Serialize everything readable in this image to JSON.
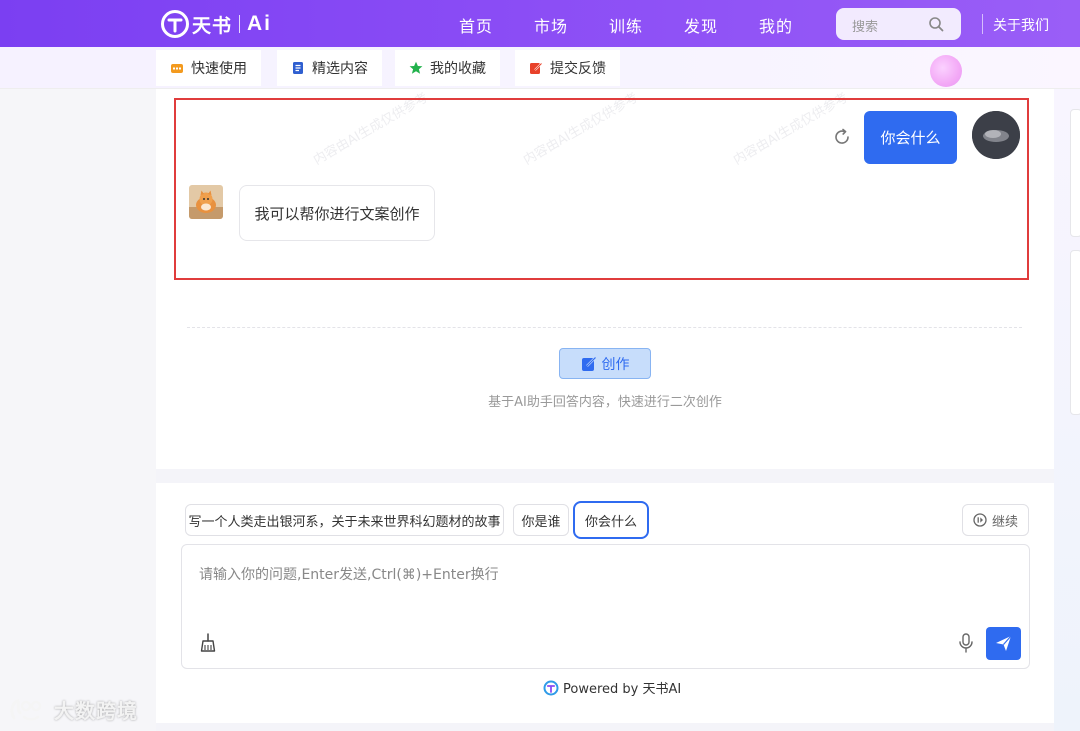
{
  "brand": {
    "name": "天书",
    "suffix": "Ai"
  },
  "nav": {
    "items": [
      "首页",
      "市场",
      "训练",
      "发现",
      "我的"
    ],
    "search_placeholder": "搜索",
    "about": "关于我们"
  },
  "subnav": {
    "tabs": [
      {
        "label": "快速使用",
        "icon": "grid-icon",
        "color": "#f39a1e"
      },
      {
        "label": "精选内容",
        "icon": "document-icon",
        "color": "#2f5fd0"
      },
      {
        "label": "我的收藏",
        "icon": "star-icon",
        "color": "#22b24c"
      },
      {
        "label": "提交反馈",
        "icon": "edit-icon",
        "color": "#e8412a"
      }
    ]
  },
  "chat": {
    "watermark": "内容由AI生成仅供参考",
    "user_message": "你会什么",
    "bot_message": "我可以帮你进行文案创作",
    "create_button": "创作",
    "create_hint": "基于AI助手回答内容，快速进行二次创作"
  },
  "composer": {
    "suggestions": [
      "写一个人类走出银河系，关于未来世界科幻题材的故事",
      "你是谁",
      "你会什么"
    ],
    "continue_label": "继续",
    "placeholder": "请输入你的问题,Enter发送,Ctrl(⌘)+Enter换行",
    "powered_by": "Powered by 天书AI"
  },
  "watermark_brand": "大数跨境",
  "colors": {
    "accent": "#2f6bf0",
    "topbar": "#7b3ff2",
    "highlight_frame": "#e03c3c"
  }
}
